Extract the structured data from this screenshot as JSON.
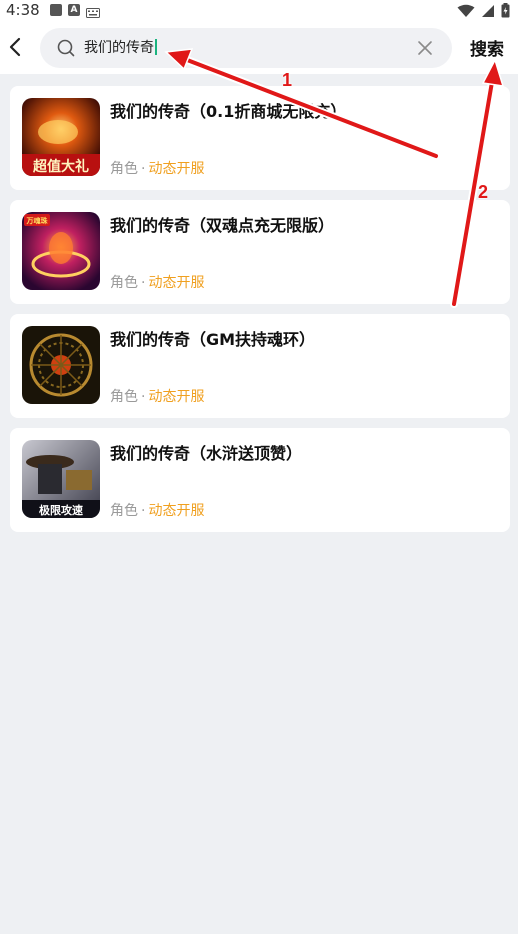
{
  "status_bar": {
    "time": "4:38"
  },
  "header": {
    "search_value": "我们的传奇",
    "search_button_label": "搜索"
  },
  "results": [
    {
      "title": "我们的传奇（0.1折商城无限充）",
      "category": "角色",
      "separator": "·",
      "tag": "动态开服",
      "icon_text": "超值大礼"
    },
    {
      "title": "我们的传奇（双魂点充无限版）",
      "category": "角色",
      "separator": "·",
      "tag": "动态开服",
      "icon_text": "万魂珠"
    },
    {
      "title": "我们的传奇（GM扶持魂环）",
      "category": "角色",
      "separator": "·",
      "tag": "动态开服"
    },
    {
      "title": "我们的传奇（水浒送顶赞）",
      "category": "角色",
      "separator": "·",
      "tag": "动态开服",
      "icon_text": "极限攻速"
    }
  ],
  "annotations": [
    {
      "label": "1"
    },
    {
      "label": "2"
    }
  ],
  "colors": {
    "accent_tag": "#f0a020",
    "caret": "#1bb37f",
    "annotation": "#e01818",
    "background": "#eef0f3"
  }
}
